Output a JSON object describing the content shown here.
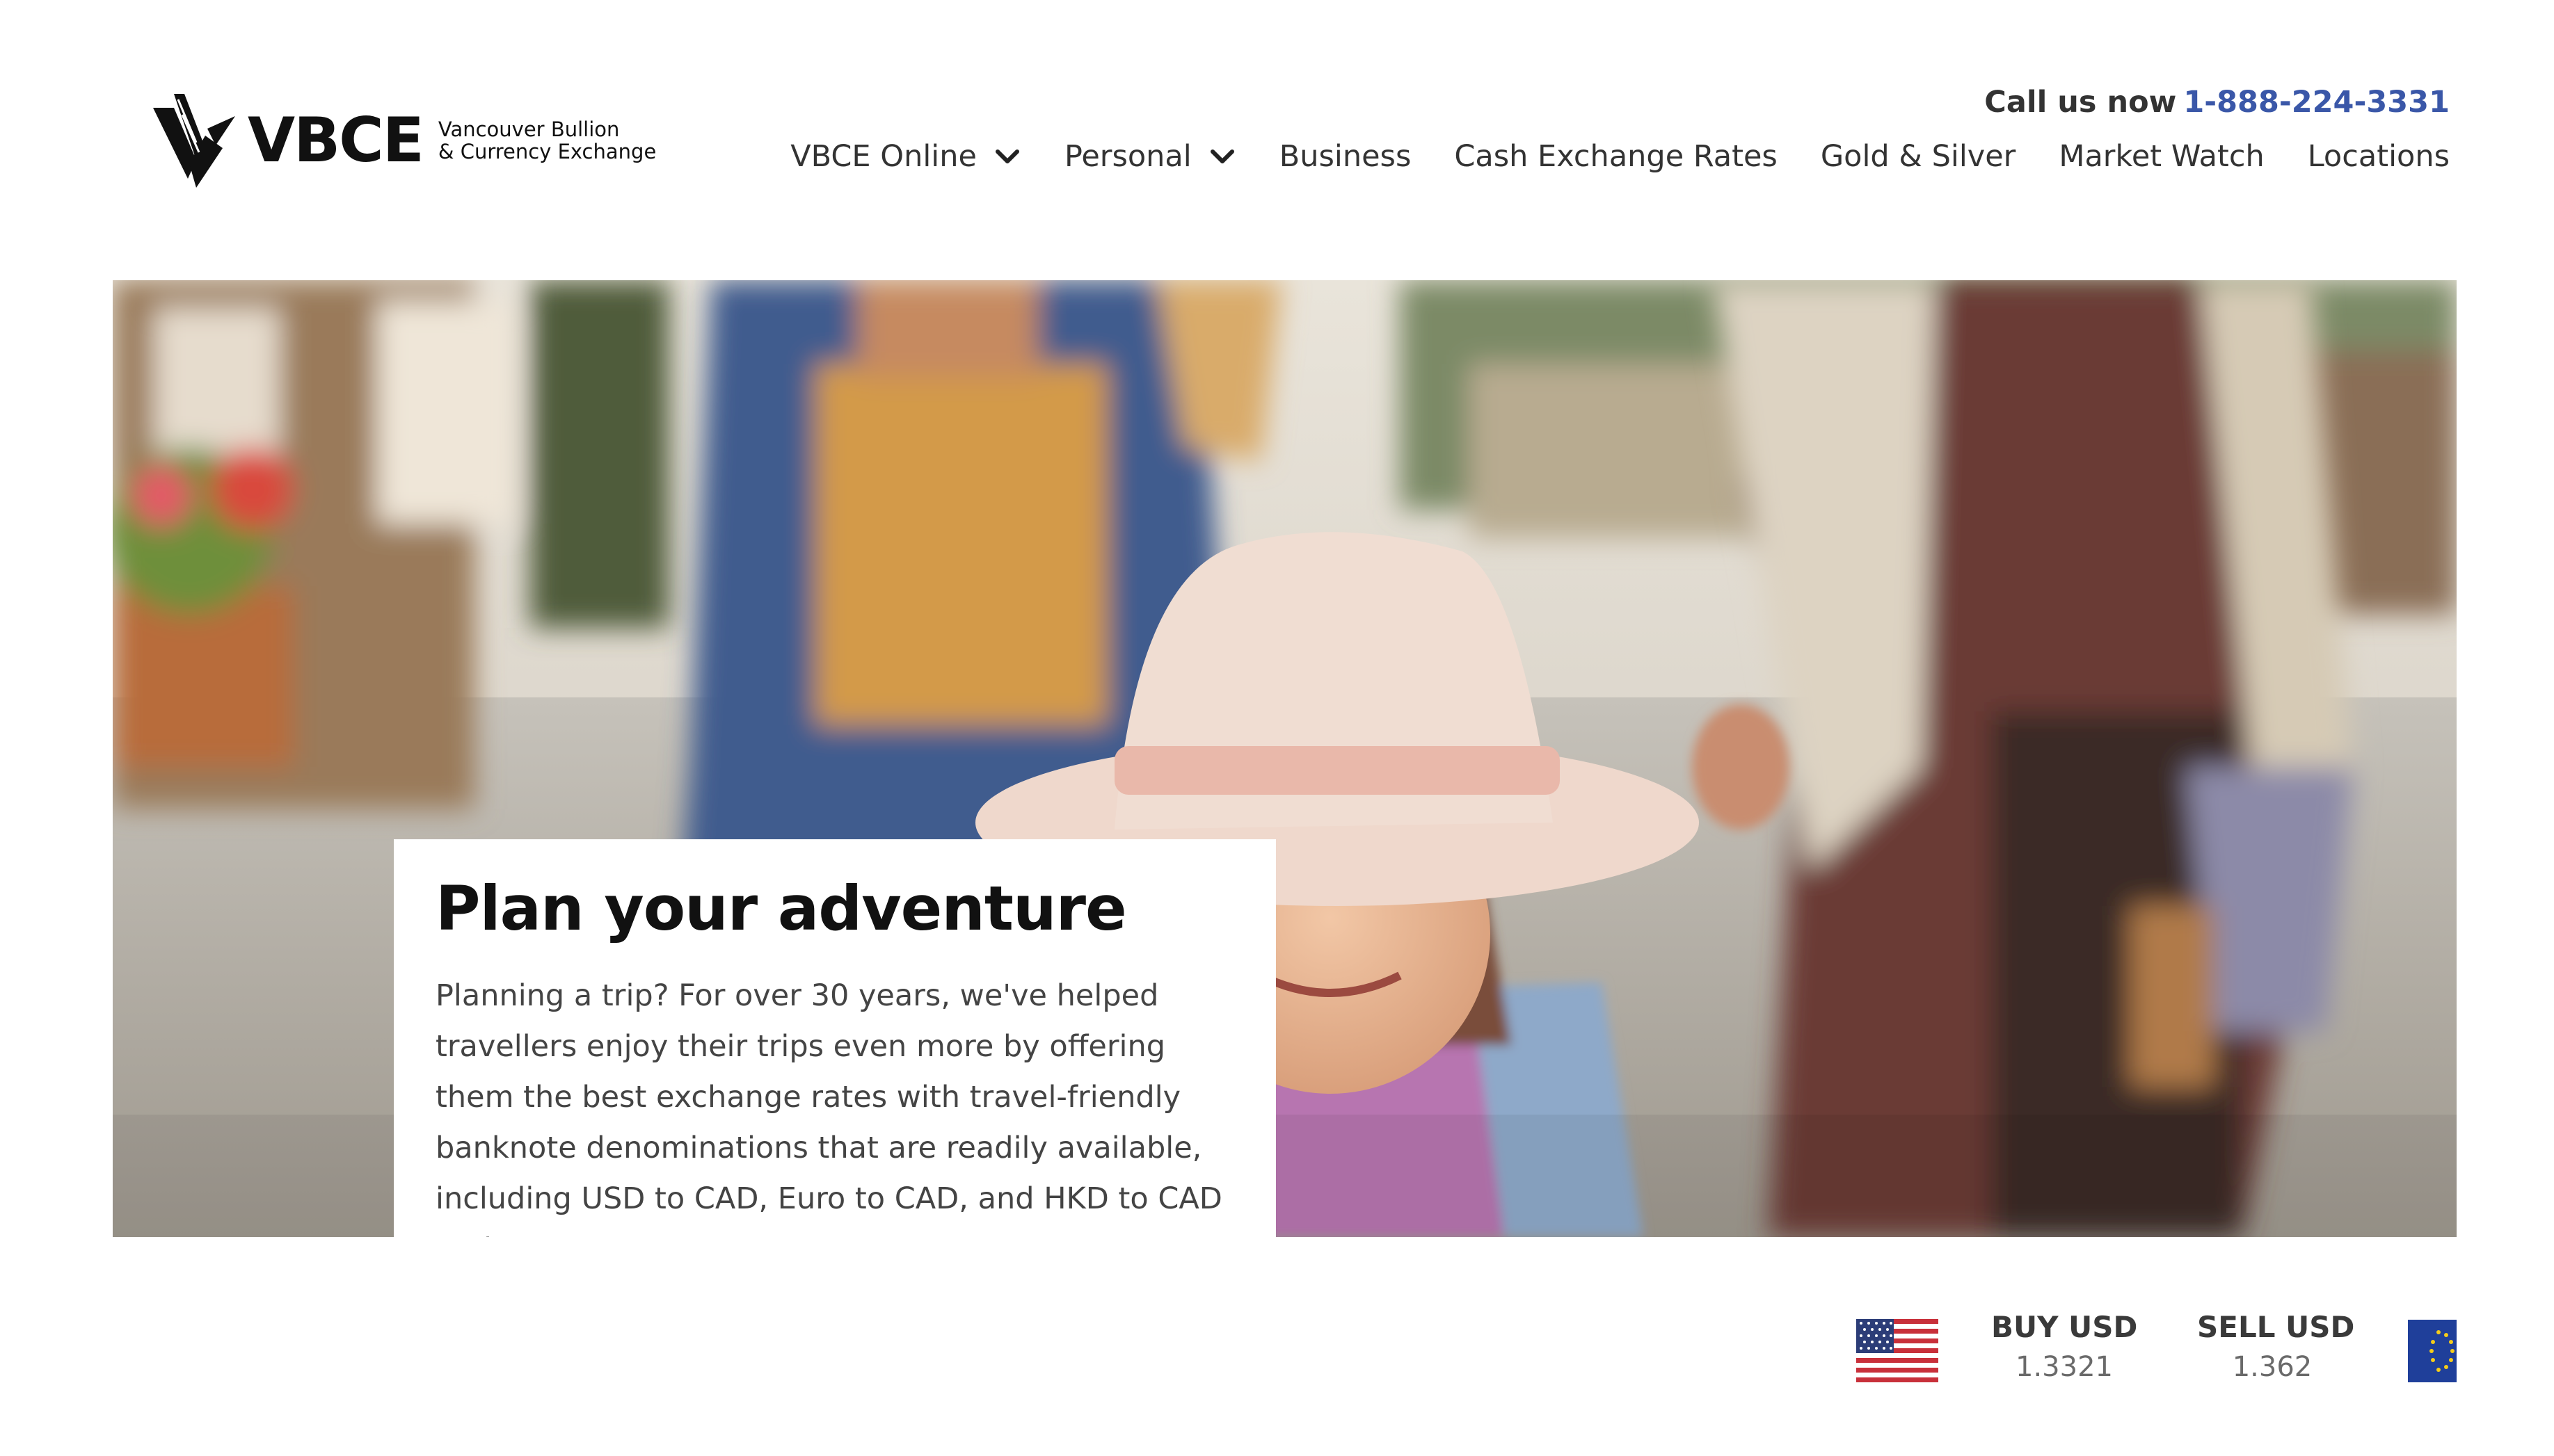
{
  "header": {
    "logo": {
      "wordmark": "VBCE",
      "subtitle_line1": "Vancouver Bullion",
      "subtitle_line2": "& Currency Exchange",
      "icon": "vbce-logo-icon"
    },
    "call_label": "Call us now",
    "phone": "1-888-224-3331",
    "nav": [
      {
        "label": "VBCE Online",
        "has_dropdown": true,
        "icon": "chevron-down-icon"
      },
      {
        "label": "Personal",
        "has_dropdown": true,
        "icon": "chevron-down-icon"
      },
      {
        "label": "Business",
        "has_dropdown": false
      },
      {
        "label": "Cash Exchange Rates",
        "has_dropdown": false
      },
      {
        "label": "Gold & Silver",
        "has_dropdown": false
      },
      {
        "label": "Market Watch",
        "has_dropdown": false
      },
      {
        "label": "Locations",
        "has_dropdown": false
      }
    ]
  },
  "hero": {
    "title": "Plan your adventure",
    "body": "Planning a trip? For over 30 years, we've helped travellers enjoy their trips even more by offering them the best exchange rates with travel-friendly banknote denominations that are readily available, including USD to CAD, Euro to CAD, and HKD to CAD and more."
  },
  "rates": {
    "flag_left": "us-flag-icon",
    "buy_label": "BUY USD",
    "buy_value": "1.3321",
    "sell_label": "SELL USD",
    "sell_value": "1.362",
    "flag_right": "eu-flag-icon"
  },
  "colors": {
    "accent": "#3a57a8",
    "text": "#333333",
    "muted": "#6a6a6a",
    "background": "#ffffff"
  }
}
